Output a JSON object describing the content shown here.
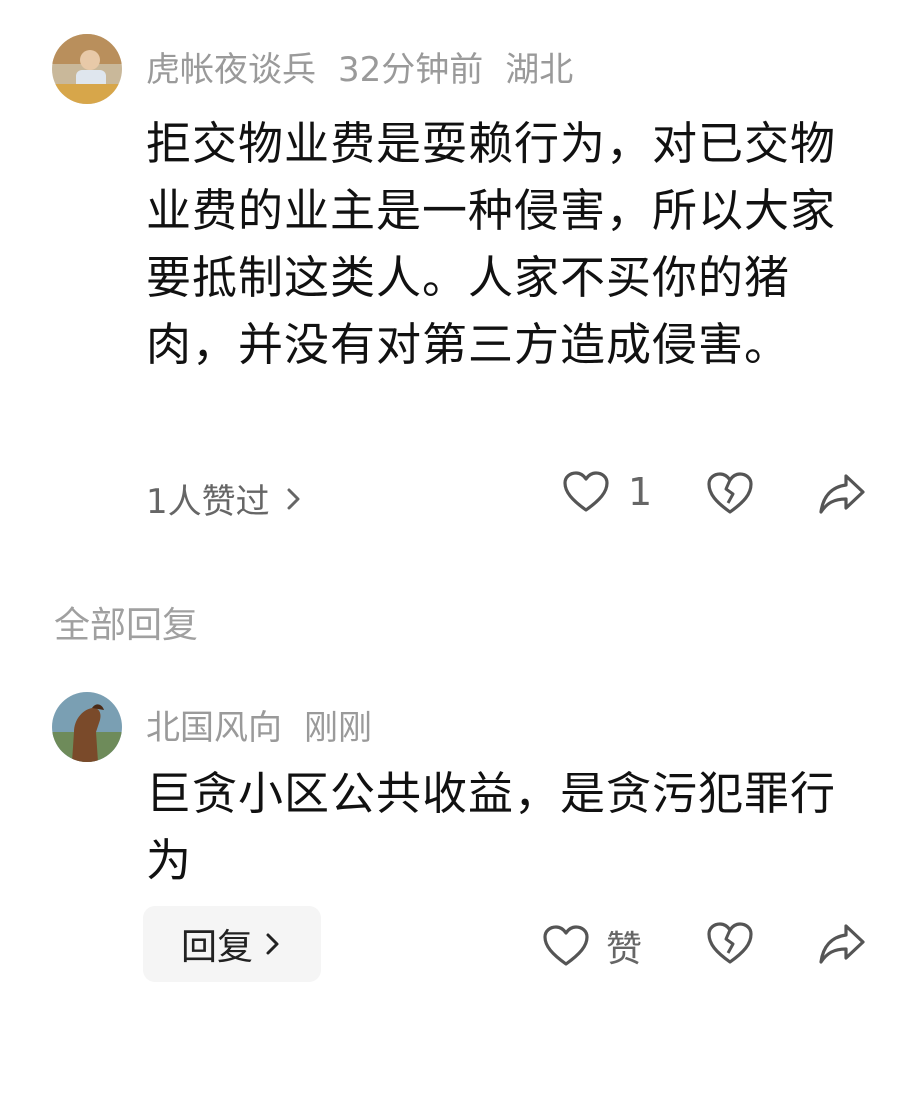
{
  "comment": {
    "author": "虎帐夜谈兵",
    "time": "32分钟前",
    "location": "湖北",
    "text": "拒交物业费是耍赖行为，对已交物业费的业主是一种侵害，所以大家要抵制这类人。人家不买你的猪肉，并没有对第三方造成侵害。",
    "likes_summary": "1人赞过",
    "like_count": "1"
  },
  "replies_section": {
    "title": "全部回复"
  },
  "reply": {
    "author": "北国风向",
    "time": "刚刚",
    "text": "巨贪小区公共收益，是贪污犯罪行为",
    "reply_button": "回复",
    "like_label": "赞"
  },
  "icons": {
    "like": "heart-icon",
    "dislike": "broken-heart-icon",
    "share": "share-arrow-icon",
    "chevron": "chevron-right-icon"
  }
}
